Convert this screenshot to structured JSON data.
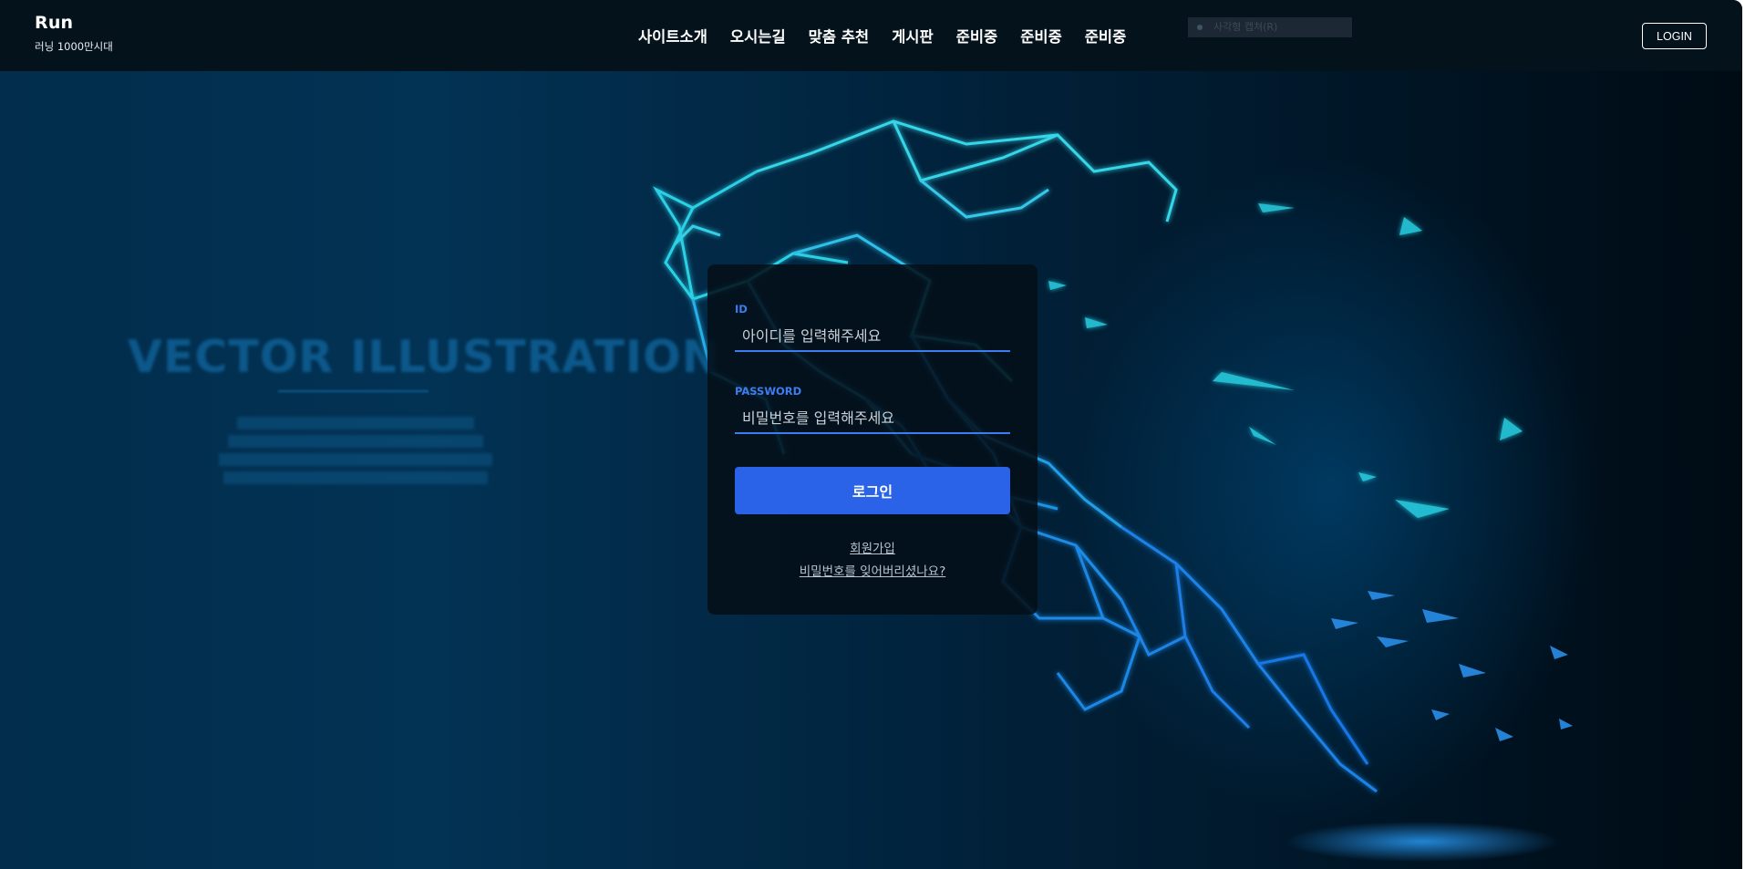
{
  "header": {
    "brand_title": "Run",
    "brand_subtitle": "러닝 1000만시대",
    "nav": [
      "사이트소개",
      "오시는길",
      "맞춤 추천",
      "게시판",
      "준비중",
      "준비중",
      "준비중"
    ],
    "capture_tip": "사각형 캡쳐(R)",
    "login_label": "LOGIN"
  },
  "hero": {
    "heading": "VECTOR ILLUSTRATION"
  },
  "login_form": {
    "id_label": "ID",
    "id_placeholder": "아이디를 입력해주세요",
    "password_label": "PASSWORD",
    "password_placeholder": "비밀번호를 입력해주세요",
    "submit_label": "로그인",
    "signup_link": "회원가입",
    "forgot_link": "비밀번호를 잊어버리셨나요?"
  },
  "colors": {
    "accent": "#2a63e8",
    "field_line": "#3c7df0",
    "header_bg": "#04121c"
  }
}
